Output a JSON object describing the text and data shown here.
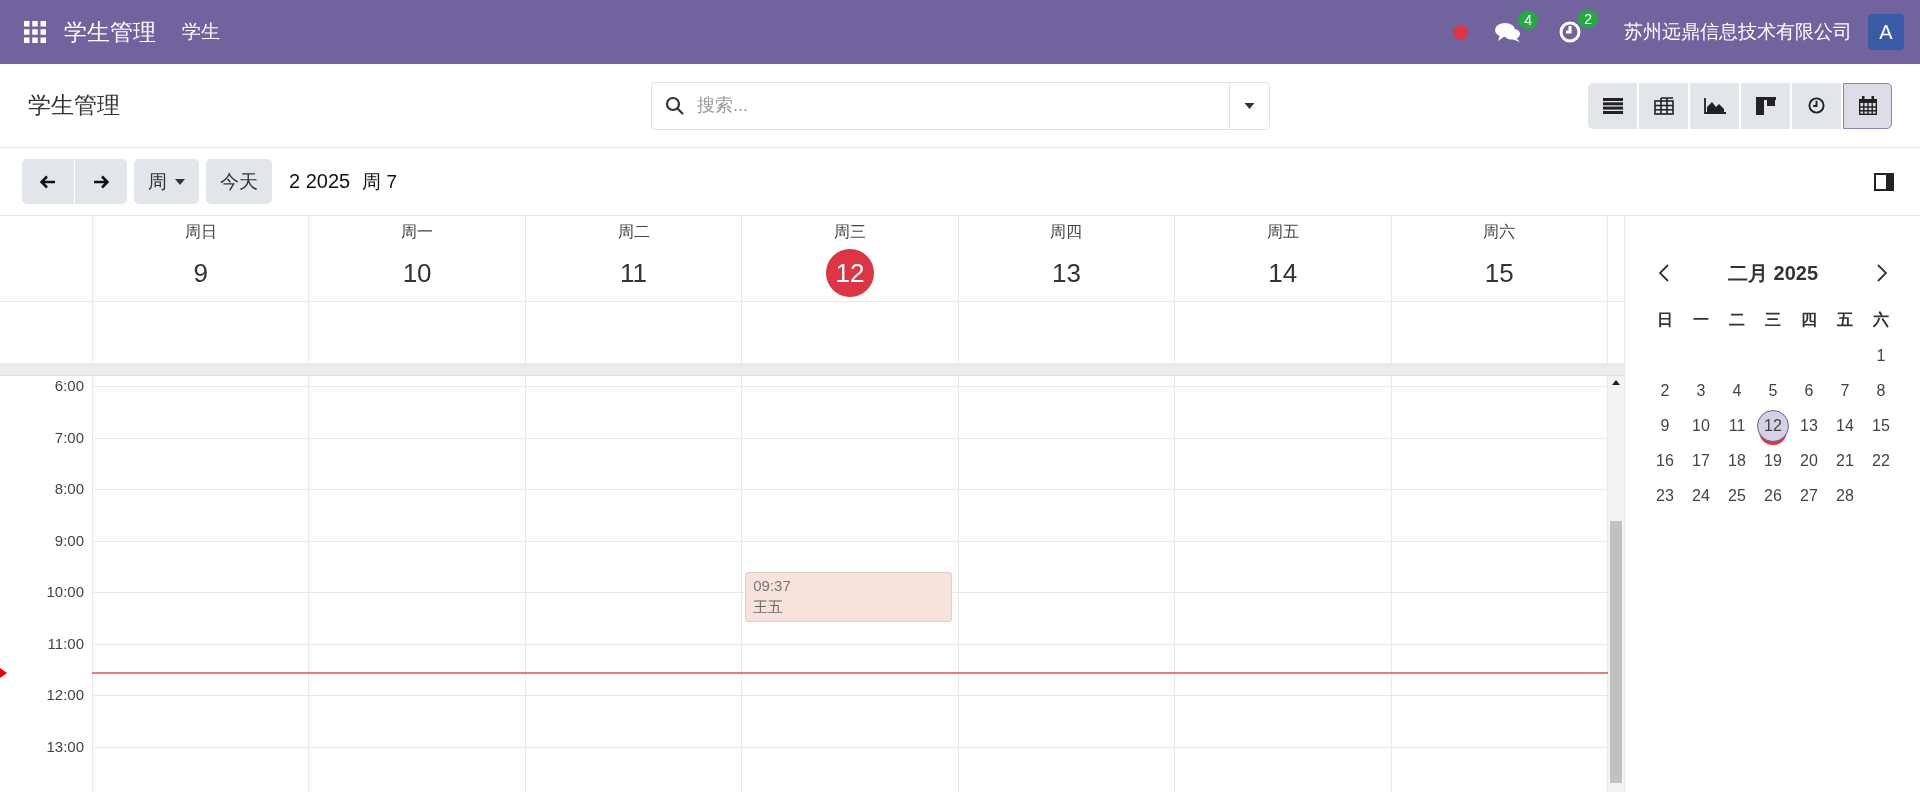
{
  "topbar": {
    "app_title": "学生管理",
    "menu": [
      "学生"
    ],
    "status_dot": {
      "color": "#dc3545"
    },
    "messages_badge": "4",
    "activities_badge": "2",
    "company": "苏州远鼎信息技术有限公司",
    "avatar": "A"
  },
  "control_panel": {
    "title": "学生管理",
    "search": {
      "placeholder": "搜索..."
    },
    "views": [
      {
        "kind": "list",
        "selected": false
      },
      {
        "kind": "pivot",
        "selected": false
      },
      {
        "kind": "graph",
        "selected": false
      },
      {
        "kind": "kanban",
        "selected": false
      },
      {
        "kind": "activity",
        "selected": false
      },
      {
        "kind": "calendar",
        "selected": true
      }
    ]
  },
  "toolbar": {
    "scale": "周",
    "today": "今天",
    "range": "2 2025",
    "week": "周 7"
  },
  "week": {
    "days": [
      {
        "weekday": "周日",
        "date": "9",
        "today": false
      },
      {
        "weekday": "周一",
        "date": "10",
        "today": false
      },
      {
        "weekday": "周二",
        "date": "11",
        "today": false
      },
      {
        "weekday": "周三",
        "date": "12",
        "today": true,
        "events": [
          {
            "time": "09:37",
            "title": "王五"
          }
        ]
      },
      {
        "weekday": "周四",
        "date": "13",
        "today": false
      },
      {
        "weekday": "周五",
        "date": "14",
        "today": false
      },
      {
        "weekday": "周六",
        "date": "15",
        "today": false
      }
    ],
    "hours": [
      "6:00",
      "7:00",
      "8:00",
      "9:00",
      "10:00",
      "11:00",
      "12:00",
      "13:00"
    ]
  },
  "mini_calendar": {
    "title": "二月 2025",
    "weekdays": [
      "日",
      "一",
      "二",
      "三",
      "四",
      "五",
      "六"
    ],
    "weeks": [
      [
        {
          "label": "1",
          "selected": false,
          "today": false
        }
      ],
      [
        {
          "label": "2",
          "selected": false,
          "today": false
        },
        {
          "label": "3",
          "selected": false,
          "today": false
        },
        {
          "label": "4",
          "selected": false,
          "today": false
        },
        {
          "label": "5",
          "selected": false,
          "today": false
        },
        {
          "label": "6",
          "selected": false,
          "today": false
        },
        {
          "label": "7",
          "selected": false,
          "today": false
        },
        {
          "label": "8",
          "selected": false,
          "today": false
        }
      ],
      [
        {
          "label": "9",
          "selected": false,
          "today": false
        },
        {
          "label": "10",
          "selected": false,
          "today": false
        },
        {
          "label": "11",
          "selected": false,
          "today": false
        },
        {
          "label": "12",
          "selected": true,
          "today": true
        },
        {
          "label": "13",
          "selected": false,
          "today": false
        },
        {
          "label": "14",
          "selected": false,
          "today": false
        },
        {
          "label": "15",
          "selected": false,
          "today": false
        }
      ],
      [
        {
          "label": "16",
          "selected": false,
          "today": false
        },
        {
          "label": "17",
          "selected": false,
          "today": false
        },
        {
          "label": "18",
          "selected": false,
          "today": false
        },
        {
          "label": "19",
          "selected": false,
          "today": false
        },
        {
          "label": "20",
          "selected": false,
          "today": false
        },
        {
          "label": "21",
          "selected": false,
          "today": false
        },
        {
          "label": "22",
          "selected": false,
          "today": false
        }
      ],
      [
        {
          "label": "23",
          "selected": false,
          "today": false
        },
        {
          "label": "24",
          "selected": false,
          "today": false
        },
        {
          "label": "25",
          "selected": false,
          "today": false
        },
        {
          "label": "26",
          "selected": false,
          "today": false
        },
        {
          "label": "27",
          "selected": false,
          "today": false
        },
        {
          "label": "28",
          "selected": false,
          "today": false
        }
      ]
    ]
  }
}
